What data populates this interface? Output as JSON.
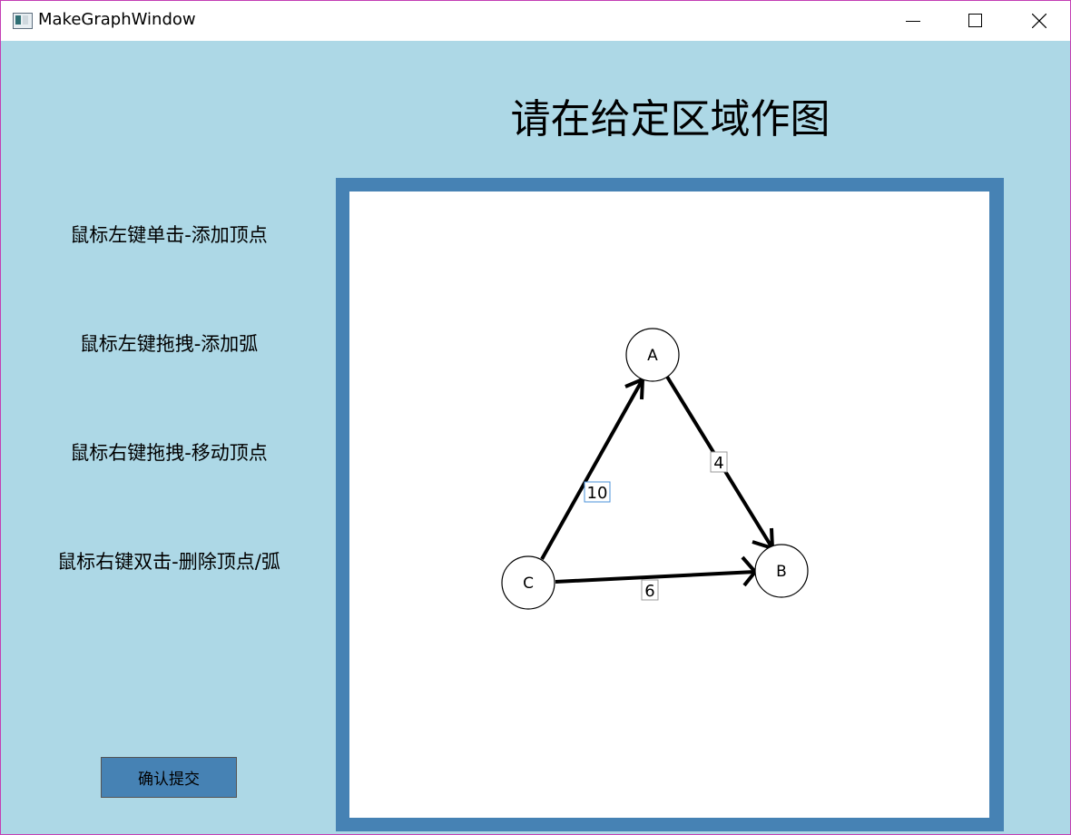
{
  "window": {
    "title": "MakeGraphWindow"
  },
  "heading": "请在给定区域作图",
  "instructions": [
    "鼠标左键单击-添加顶点",
    "鼠标左键拖拽-添加弧",
    "鼠标右键拖拽-移动顶点",
    "鼠标右键双击-删除顶点/弧"
  ],
  "submit_button": "确认提交",
  "graph": {
    "vertices": [
      {
        "label": "A"
      },
      {
        "label": "B"
      },
      {
        "label": "C"
      }
    ],
    "edges": [
      {
        "from": "C",
        "to": "A",
        "weight": "10",
        "focused": true
      },
      {
        "from": "A",
        "to": "B",
        "weight": "4",
        "focused": false
      },
      {
        "from": "C",
        "to": "B",
        "weight": "6",
        "focused": false
      }
    ]
  },
  "colors": {
    "background": "#add8e6",
    "canvas_border": "#4682b4",
    "button": "#4682b4",
    "focused_label_border": "#4a90d9"
  }
}
